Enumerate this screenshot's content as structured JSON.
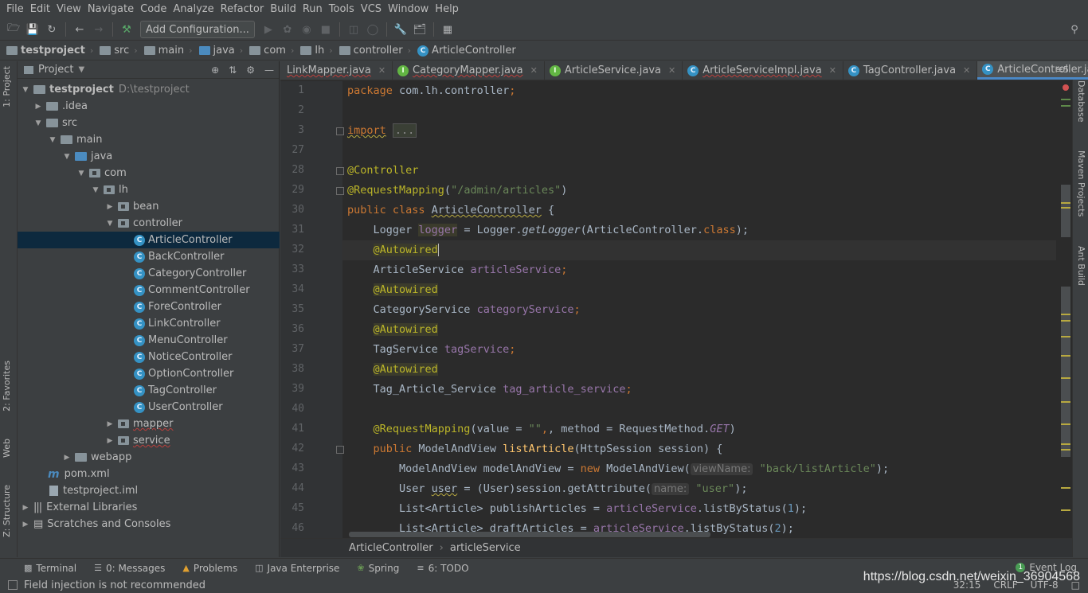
{
  "menu": [
    "File",
    "Edit",
    "View",
    "Navigate",
    "Code",
    "Analyze",
    "Refactor",
    "Build",
    "Run",
    "Tools",
    "VCS",
    "Window",
    "Help"
  ],
  "toolbar": {
    "add_config_label": "Add Configuration..."
  },
  "nav": [
    "testproject",
    "src",
    "main",
    "java",
    "com",
    "lh",
    "controller",
    "ArticleController"
  ],
  "left_strip": {
    "project": "1: Project",
    "favorites": "2: Favorites",
    "web": "Web",
    "structure": "Z: Structure"
  },
  "right_strip": {
    "database": "Database",
    "maven": "Maven Projects",
    "ant": "Ant Build"
  },
  "project_panel": {
    "title": "Project",
    "tree": [
      {
        "label": "testproject",
        "path": "D:\\testproject"
      },
      {
        "label": ".idea"
      },
      {
        "label": "src"
      },
      {
        "label": "main"
      },
      {
        "label": "java"
      },
      {
        "label": "com"
      },
      {
        "label": "lh"
      },
      {
        "label": "bean"
      },
      {
        "label": "controller"
      },
      {
        "label": "ArticleController"
      },
      {
        "label": "BackController"
      },
      {
        "label": "CategoryController"
      },
      {
        "label": "CommentController"
      },
      {
        "label": "ForeController"
      },
      {
        "label": "LinkController"
      },
      {
        "label": "MenuController"
      },
      {
        "label": "NoticeController"
      },
      {
        "label": "OptionController"
      },
      {
        "label": "TagController"
      },
      {
        "label": "UserController"
      },
      {
        "label": "mapper"
      },
      {
        "label": "service"
      },
      {
        "label": "webapp"
      },
      {
        "label": "pom.xml"
      },
      {
        "label": "testproject.iml"
      },
      {
        "label": "External Libraries"
      },
      {
        "label": "Scratches and Consoles"
      }
    ]
  },
  "tabs": [
    "LinkMapper.java",
    "CategoryMapper.java",
    "ArticleService.java",
    "ArticleServiceImpl.java",
    "TagController.java",
    "ArticleController.java"
  ],
  "tabs_more": "5",
  "line_numbers": [
    "1",
    "2",
    "3",
    "27",
    "28",
    "29",
    "30",
    "31",
    "32",
    "33",
    "34",
    "35",
    "36",
    "37",
    "38",
    "39",
    "40",
    "41",
    "42",
    "43",
    "44",
    "45",
    "46"
  ],
  "code": {
    "l1_kw": "package",
    "l1_rest": " com.lh.controller",
    "l1_semi": ";",
    "l3_kw": "import",
    "l3_fold": "...",
    "l28": "@Controller",
    "l29_ann": "@RequestMapping",
    "l29_p1": "(",
    "l29_str": "\"/admin/articles\"",
    "l29_p2": ")",
    "l30_kw": "public class ",
    "l30_name": "ArticleController",
    "l30_brace": " {",
    "l31_type": "    Logger ",
    "l31_field": "logger",
    "l31_eq": " = Logger.",
    "l31_method": "getLogger",
    "l31_arg": "(ArticleController.",
    "l31_kw": "class",
    "l31_end": ");",
    "autowired": "@Autowired",
    "l33_type": "    ArticleService ",
    "l33_field": "articleService",
    "l35_type": "    CategoryService ",
    "l35_field": "categoryService",
    "l37_type": "    TagService ",
    "l37_field": "tagService",
    "l39_type": "    Tag_Article_Service ",
    "l39_field": "tag_article_service",
    "semi": ";",
    "l41_ann": "@RequestMapping",
    "l41_a": "(value = ",
    "l41_str": "\"\"",
    "l41_b": ", method = RequestMethod.",
    "l41_get": "GET",
    "l41_c": ")",
    "l42_kw": "public",
    "l42_a": " ModelAndView ",
    "l42_m": "listArticle",
    "l42_b": "(HttpSession session) {",
    "l43_a": "        ModelAndView modelAndView = ",
    "l43_kw": "new",
    "l43_b": " ModelAndView(",
    "l43_hint": "viewName:",
    "l43_str": "\"back/listArticle\"",
    "l43_c": ");",
    "l44_a": "        User ",
    "l44_var": "user",
    "l44_b": " = (User)session.getAttribute(",
    "l44_hint": "name:",
    "l44_str": "\"user\"",
    "l44_c": ");",
    "l45_a": "        List<Article> publishArticles = ",
    "l45_f": "articleService",
    "l45_b": ".listByStatus(",
    "l45_n": "1",
    "l45_c": ");",
    "l46_a": "        List<Article> draftArticles = ",
    "l46_f": "articleService",
    "l46_b": ".listByStatus(",
    "l46_n": "2",
    "l46_c": ");"
  },
  "editor_breadcrumb": [
    "ArticleController",
    "articleService"
  ],
  "bottom_tabs": [
    "Terminal",
    "0: Messages",
    "Problems",
    "Java Enterprise",
    "Spring",
    "6: TODO"
  ],
  "event_log": "Event Log",
  "status": {
    "message": "Field injection is not recommended",
    "position": "32:15",
    "line_sep": "CRLF",
    "encoding": "UTF-8"
  },
  "watermark": "https://blog.csdn.net/weixin_36904568"
}
